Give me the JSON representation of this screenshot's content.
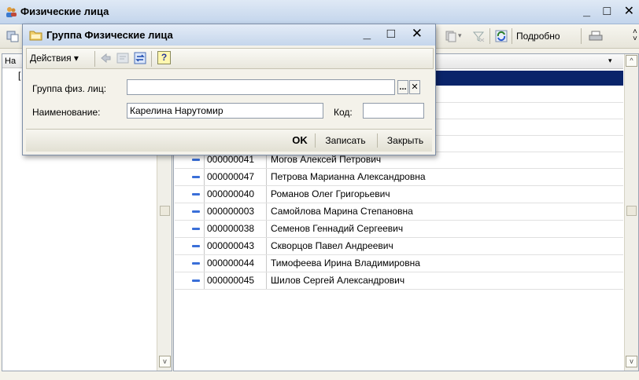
{
  "window": {
    "title": "Физические лица",
    "controls": "_ □ ✕"
  },
  "toolbar": {
    "details_label": "Подробно"
  },
  "left_panel": {
    "header": "На",
    "tree_item": "["
  },
  "dialog": {
    "title": "Группа Физические лица",
    "controls": "_ □ ✕",
    "actions_label": "Действия ▾",
    "help_icon_text": "?",
    "group_label": "Группа физ. лиц:",
    "group_value": "",
    "group_select_btn": "...",
    "group_clear_btn": "✕",
    "name_label": "Наименование:",
    "name_value": "Карелина Нарутомир",
    "code_label": "Код:",
    "code_value": "",
    "ok_label": "OK",
    "save_label": "Записать",
    "close_label": "Закрыть"
  },
  "list": {
    "rows": [
      {
        "code": "000000041",
        "name": "Могов Алексей Петрович"
      },
      {
        "code": "000000047",
        "name": "Петрова Марианна Александровна"
      },
      {
        "code": "000000040",
        "name": "Романов Олег Григорьевич"
      },
      {
        "code": "000000003",
        "name": "Самойлова Марина Степановна"
      },
      {
        "code": "000000038",
        "name": "Семенов Геннадий Сергеевич"
      },
      {
        "code": "000000043",
        "name": "Скворцов Павел Андреевич"
      },
      {
        "code": "000000044",
        "name": "Тимофеева Ирина Владимировна"
      },
      {
        "code": "000000045",
        "name": "Шилов Сергей Александрович"
      }
    ]
  },
  "icons": {
    "window_icon": "people-icon",
    "folder_icon": "folder-icon",
    "print_icon": "printer-icon",
    "refresh_icon": "refresh-icon",
    "filter_off_icon": "filter-off-icon"
  },
  "colors": {
    "selection": "#0a246a",
    "title_bar": "#c3d5ec",
    "row_marker": "#3a6fd8"
  }
}
